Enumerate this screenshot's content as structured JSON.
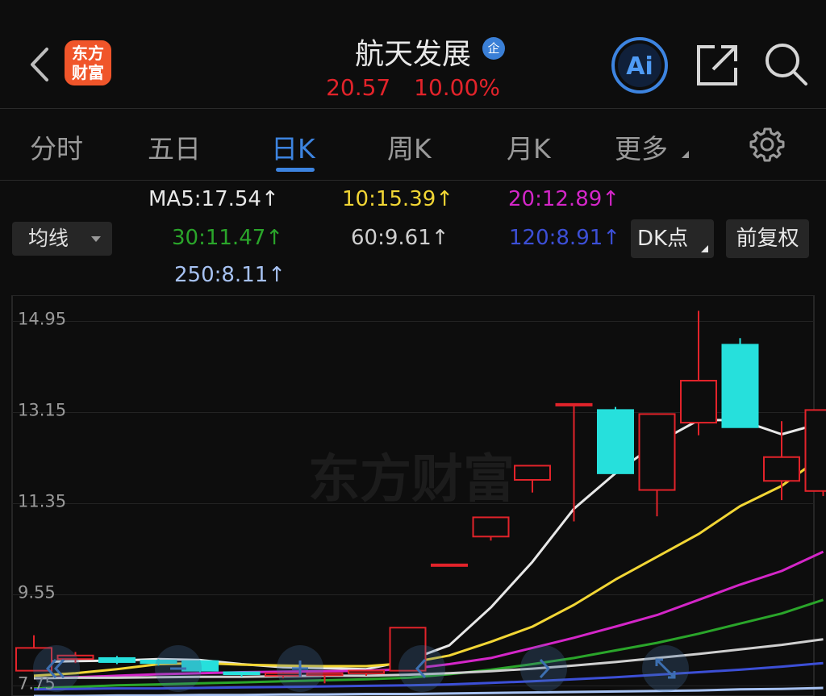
{
  "header": {
    "logo_line1": "东方",
    "logo_line2": "财富",
    "stock_name": "航天发展",
    "badge": "企",
    "price": "20.57",
    "change_pct": "10.00%",
    "ai_label": "Ai",
    "back_icon": "chevron-left-icon",
    "share_icon": "share-icon",
    "search_icon": "search-icon"
  },
  "tabs": [
    {
      "label": "分时",
      "active": false
    },
    {
      "label": "五日",
      "active": false
    },
    {
      "label": "日K",
      "active": true
    },
    {
      "label": "周K",
      "active": false
    },
    {
      "label": "月K",
      "active": false
    },
    {
      "label": "更多",
      "active": false
    }
  ],
  "settings_icon": "gear-icon",
  "ma_selector": "均线",
  "ma_values": [
    {
      "label": "MA5:17.54",
      "arrow": "↑",
      "color": "#e8e8e8"
    },
    {
      "label": "10:15.39",
      "arrow": "↑",
      "color": "#f2d635"
    },
    {
      "label": "20:12.89",
      "arrow": "↑",
      "color": "#d426c8"
    },
    {
      "label": "30:11.47",
      "arrow": "↑",
      "color": "#2aa52a"
    },
    {
      "label": "60:9.61",
      "arrow": "↑",
      "color": "#cfcfcf"
    },
    {
      "label": "120:8.91",
      "arrow": "↑",
      "color": "#3c4fd6"
    },
    {
      "label": "250:8.11",
      "arrow": "↑",
      "color": "#a7c2f2"
    }
  ],
  "dk_button": "DK点",
  "fq_button": "前复权",
  "watermark": "东方财富",
  "colors": {
    "up": "#e2232a",
    "down": "#26e0dc",
    "accent": "#3d84e0"
  },
  "chart_data": {
    "type": "candlestick",
    "y_ticks": [
      "14.95",
      "13.15",
      "11.35",
      "9.55",
      "7.75"
    ],
    "ylim": [
      7.55,
      15.15
    ],
    "candles": [
      {
        "o": 8.05,
        "c": 8.5,
        "h": 8.75,
        "l": 8.05
      },
      {
        "o": 8.28,
        "c": 8.35,
        "h": 8.42,
        "l": 8.2
      },
      {
        "o": 8.3,
        "c": 8.22,
        "h": 8.34,
        "l": 8.18
      },
      {
        "o": 8.25,
        "c": 8.2,
        "h": 8.28,
        "l": 8.15
      },
      {
        "o": 8.24,
        "c": 8.05,
        "h": 8.26,
        "l": 8.02
      },
      {
        "o": 8.02,
        "c": 7.98,
        "h": 8.02,
        "l": 7.93
      },
      {
        "o": 7.95,
        "c": 8.0,
        "h": 8.02,
        "l": 7.9
      },
      {
        "o": 7.96,
        "c": 8.0,
        "h": 8.0,
        "l": 7.8
      },
      {
        "o": 8.0,
        "c": 8.05,
        "h": 8.05,
        "l": 7.95
      },
      {
        "o": 8.05,
        "c": 8.9,
        "h": 8.9,
        "l": 8.05
      },
      {
        "o": 10.15,
        "c": 10.15,
        "h": 10.15,
        "l": 10.15
      },
      {
        "o": 10.7,
        "c": 11.08,
        "h": 11.08,
        "l": 10.62
      },
      {
        "o": 11.82,
        "c": 12.1,
        "h": 12.1,
        "l": 11.57
      },
      {
        "o": 13.32,
        "c": 13.32,
        "h": 13.32,
        "l": 11.0
      },
      {
        "o": 13.2,
        "c": 11.95,
        "h": 13.26,
        "l": 11.95
      },
      {
        "o": 11.62,
        "c": 13.12,
        "h": 13.12,
        "l": 11.1
      },
      {
        "o": 12.95,
        "c": 13.78,
        "h": 15.16,
        "l": 12.7
      },
      {
        "o": 14.49,
        "c": 12.86,
        "h": 14.62,
        "l": 12.86
      },
      {
        "o": 11.8,
        "c": 12.27,
        "h": 12.98,
        "l": 11.42
      },
      {
        "o": 11.6,
        "c": 13.2,
        "h": 13.2,
        "l": 11.5
      }
    ],
    "series": [
      {
        "name": "MA5",
        "color": "#e8e8e8",
        "values": [
          8.22,
          8.24,
          8.25,
          8.28,
          8.26,
          8.18,
          8.12,
          8.1,
          8.08,
          8.25,
          8.55,
          9.3,
          10.2,
          11.25,
          11.95,
          12.55,
          13.0,
          13.0,
          12.72,
          12.95
        ]
      },
      {
        "name": "10",
        "color": "#f2d635",
        "values": [
          7.95,
          8.0,
          8.08,
          8.18,
          8.2,
          8.17,
          8.15,
          8.14,
          8.14,
          8.2,
          8.35,
          8.62,
          8.92,
          9.35,
          9.85,
          10.3,
          10.75,
          11.3,
          11.7,
          12.3
        ]
      },
      {
        "name": "20",
        "color": "#d426c8",
        "values": [
          7.9,
          7.92,
          7.95,
          7.98,
          8.0,
          8.02,
          8.03,
          8.04,
          8.05,
          8.08,
          8.18,
          8.3,
          8.5,
          8.7,
          8.92,
          9.15,
          9.45,
          9.75,
          10.02,
          10.4
        ]
      },
      {
        "name": "30",
        "color": "#2aa52a",
        "values": [
          7.7,
          7.73,
          7.76,
          7.78,
          7.8,
          7.82,
          7.84,
          7.86,
          7.88,
          7.91,
          7.98,
          8.07,
          8.18,
          8.3,
          8.45,
          8.6,
          8.78,
          8.98,
          9.18,
          9.45
        ]
      },
      {
        "name": "60",
        "color": "#cfcfcf",
        "values": [
          7.9,
          7.91,
          7.91,
          7.92,
          7.93,
          7.93,
          7.94,
          7.95,
          7.95,
          7.97,
          8.0,
          8.04,
          8.09,
          8.15,
          8.22,
          8.3,
          8.38,
          8.47,
          8.56,
          8.67
        ]
      },
      {
        "name": "120",
        "color": "#3c4fd6",
        "values": [
          7.68,
          7.69,
          7.7,
          7.7,
          7.71,
          7.72,
          7.73,
          7.74,
          7.75,
          7.76,
          7.78,
          7.81,
          7.84,
          7.88,
          7.92,
          7.97,
          8.02,
          8.07,
          8.13,
          8.2
        ]
      },
      {
        "name": "250",
        "color": "#a7c2f2",
        "values": [
          7.55,
          7.55,
          7.56,
          7.56,
          7.57,
          7.57,
          7.58,
          7.58,
          7.59,
          7.59,
          7.6,
          7.61,
          7.62,
          7.63,
          7.64,
          7.65,
          7.66,
          7.68,
          7.69,
          7.71
        ]
      }
    ]
  }
}
